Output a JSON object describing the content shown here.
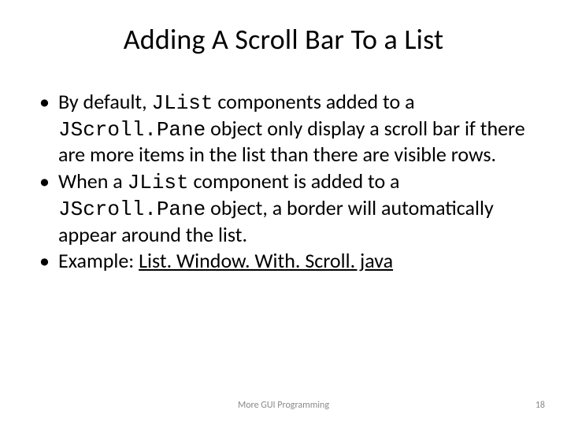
{
  "slide": {
    "title": "Adding A Scroll Bar To a List",
    "bullets": [
      {
        "seg0": "By default, ",
        "code0": "JList",
        "seg1": " components added to a ",
        "code1": "JScroll.Pane",
        "seg2": " object only display a scroll bar if there are more items in the list than there are visible rows."
      },
      {
        "seg0": "When a ",
        "code0": "JList",
        "seg1": " component is added to a ",
        "code1": "JScroll.Pane",
        "seg2": " object, a border will automatically appear around the list."
      },
      {
        "seg0": "Example: ",
        "link": "List. Window. With. Scroll. java"
      }
    ],
    "footer_center": "More GUI Programming",
    "page_number": "18"
  }
}
